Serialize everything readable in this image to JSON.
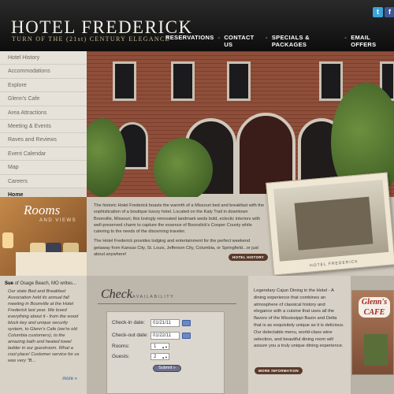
{
  "header": {
    "title": "HOTEL FREDERICK",
    "subtitle": "TURN OF THE (21st) CENTURY ELEGANCE",
    "nav": [
      "RESERVATIONS",
      "CONTACT US",
      "SPECIALS & PACKAGES",
      "EMAIL OFFERS"
    ],
    "separator": "-",
    "social": {
      "twitter": "t",
      "facebook": "f"
    }
  },
  "sidebar": {
    "items": [
      {
        "label": "Hotel History"
      },
      {
        "label": "Accommodations"
      },
      {
        "label": "Explore"
      },
      {
        "label": "Glenn's Cafe"
      },
      {
        "label": "Area Attractions"
      },
      {
        "label": "Meeting & Events"
      },
      {
        "label": "Raves and Reviews"
      },
      {
        "label": "Event Calendar"
      },
      {
        "label": "Map"
      },
      {
        "label": "Careers"
      },
      {
        "label": "Home"
      }
    ]
  },
  "rooms": {
    "title": "Rooms",
    "subtitle": "AND VIEWS"
  },
  "intro": {
    "p1": "The historic Hotel Frederick boasts the warmth of a Missouri bed and breakfast with the sophistication of a boutique luxury hotel. Located on the Katy Trail in downtown Boonville, Missouri, this lovingly renovated landmark weds bold, eclectic interiors with well-preserved charm to capture the essence of Boonslick's Cooper County while catering to the needs of the discerning traveler.",
    "p2": "The Hotel Frederick provides lodging and entertainment for the perfect weekend getaway from Kansas City, St. Louis, Jefferson City, Columbia, or Springfield...or just about anywhere!",
    "button": "HOTEL HISTORY",
    "photo_caption": "HOTEL FREDERICK"
  },
  "review": {
    "author": "Sue",
    "location": "of Osage Beach, MO writes...",
    "text": "Our state Bed and Breakfast Association held its annual fall meeting in Boonville at the Hotel Frederick last year. We loved everything about it - from the wood block key and unique security system, to Glenn's Cafe (we're old Columbia customers), to the amazing bath and heated towel ladder in our guestroom. What a cool place! Customer service for us was very \"B...",
    "more": "more »"
  },
  "availability": {
    "title": "Check",
    "subtitle": "AVAILABILITY",
    "checkin_label": "Check-in date:",
    "checkin_value": "01/21/11",
    "checkout_label": "Check-out date:",
    "checkout_value": "01/22/11",
    "rooms_label": "Rooms:",
    "rooms_value": "1",
    "guests_label": "Guests:",
    "guests_value": "2",
    "submit": "Submit »"
  },
  "cajun": {
    "text": "Legendary Cajun Dining in the Hotel - A dining experience that combines an atmosphere of classical history and elegance with a cuisine that uses all the flavors of the Mississippi Basin and Delta that is as exquisitely unique as it is delicious. Our delectable menu, world-class wine selection, and beautiful dining room will assure you a truly unique dining experience.",
    "button": "MORE INFORMATION",
    "cafe_sign": "Glenn's CAFE"
  }
}
